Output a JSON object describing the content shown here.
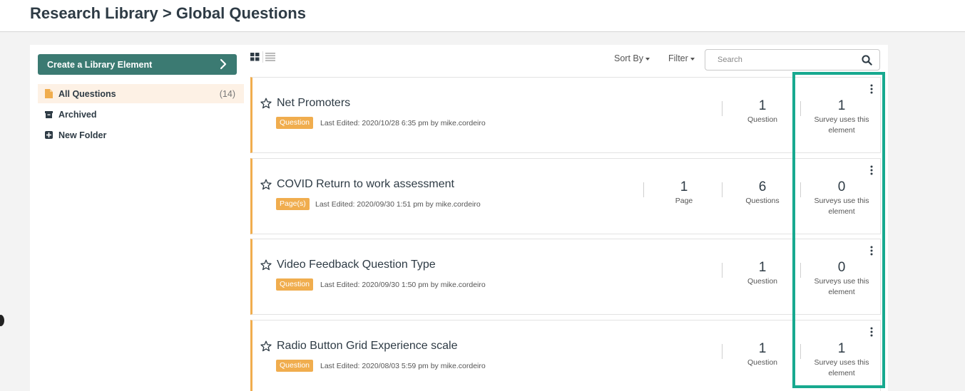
{
  "header": {
    "title": "Research Library > Global Questions"
  },
  "sidebar": {
    "create_label": "Create a Library Element",
    "items": [
      {
        "label": "All Questions",
        "count": "(14)",
        "icon": "file-icon",
        "active": true
      },
      {
        "label": "Archived",
        "count": "",
        "icon": "archive-icon",
        "active": false
      },
      {
        "label": "New Folder",
        "count": "",
        "icon": "plus-square-icon",
        "active": false
      }
    ]
  },
  "toolbar": {
    "sort_label": "Sort By",
    "filter_label": "Filter",
    "search_placeholder": "Search",
    "search_value": ""
  },
  "rows": [
    {
      "title": "Net Promoters",
      "badge": "Question",
      "meta": "Last Edited: 2020/10/28 6:35 pm by mike.cordeiro",
      "stats": [
        {
          "num": "1",
          "label": "Question"
        }
      ],
      "surveys": {
        "num": "1",
        "label": "Survey uses this element"
      }
    },
    {
      "title": "COVID Return to work assessment",
      "badge": "Page(s)",
      "meta": "Last Edited: 2020/09/30 1:51 pm by mike.cordeiro",
      "stats": [
        {
          "num": "1",
          "label": "Page"
        },
        {
          "num": "6",
          "label": "Questions"
        }
      ],
      "surveys": {
        "num": "0",
        "label": "Surveys use this element"
      }
    },
    {
      "title": "Video Feedback Question Type",
      "badge": "Question",
      "meta": "Last Edited: 2020/09/30 1:50 pm by mike.cordeiro",
      "stats": [
        {
          "num": "1",
          "label": "Question"
        }
      ],
      "surveys": {
        "num": "0",
        "label": "Surveys use this element"
      }
    },
    {
      "title": "Radio Button Grid Experience scale",
      "badge": "Question",
      "meta": "Last Edited: 2020/08/03 5:59 pm by mike.cordeiro",
      "stats": [
        {
          "num": "1",
          "label": "Question"
        }
      ],
      "surveys": {
        "num": "1",
        "label": "Survey uses this element"
      }
    }
  ],
  "colors": {
    "accent": "#3b7a72",
    "badge": "#f0ad4e",
    "highlight": "#17a98f",
    "active_bg": "#fdf1e5"
  }
}
